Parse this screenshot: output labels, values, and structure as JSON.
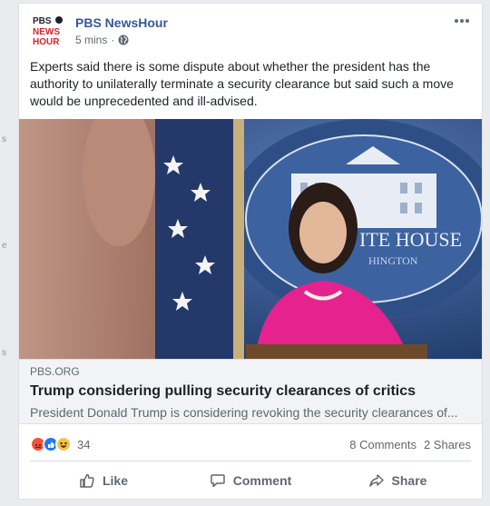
{
  "left_strip": {
    "glyphs": [
      "s",
      "e",
      "s"
    ]
  },
  "post": {
    "page_name": "PBS NewsHour",
    "avatar_text": [
      "PBS",
      "NEWS",
      "HOUR"
    ],
    "timestamp": "5 mins",
    "separator": "·",
    "privacy_icon": "globe-icon",
    "text": "Experts said there is some dispute about whether the president has the authority to unilaterally terminate a security clearance but said such a move would be unprecedented and ill-advised."
  },
  "hero_image": {
    "sign_text": "ITE HOUSE",
    "sign_sub": "HINGTON"
  },
  "link": {
    "domain": "PBS.ORG",
    "title": "Trump considering pulling security clearances of critics",
    "description": "President Donald Trump is considering revoking the security clearances of..."
  },
  "stats": {
    "reaction_icons": [
      "angry-reaction-icon",
      "like-reaction-icon",
      "haha-reaction-icon"
    ],
    "reaction_count": "34",
    "comments": "8 Comments",
    "shares": "2 Shares"
  },
  "actions": {
    "like": "Like",
    "comment": "Comment",
    "share": "Share"
  },
  "colors": {
    "link_blue": "#365899",
    "angry": "#f0533b",
    "like": "#2078f4",
    "haha": "#f7c34a",
    "pink_jacket": "#e6228f"
  }
}
